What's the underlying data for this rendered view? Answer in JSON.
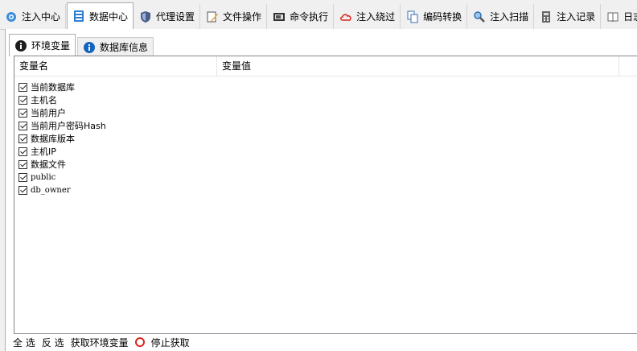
{
  "top_tabs": [
    {
      "label": "注入中心",
      "icon": "gear-icon"
    },
    {
      "label": "数据中心",
      "icon": "database-icon"
    },
    {
      "label": "代理设置",
      "icon": "shield-icon"
    },
    {
      "label": "文件操作",
      "icon": "edit-file-icon"
    },
    {
      "label": "命令执行",
      "icon": "terminal-icon"
    },
    {
      "label": "注入绕过",
      "icon": "cloud-icon"
    },
    {
      "label": "编码转换",
      "icon": "copy-icon"
    },
    {
      "label": "注入扫描",
      "icon": "magnifier-icon"
    },
    {
      "label": "注入记录",
      "icon": "calculator-icon"
    },
    {
      "label": "日志",
      "icon": "book-icon"
    }
  ],
  "active_top_tab": "数据中心",
  "sub_tabs": [
    {
      "label": "环境变量",
      "icon": "info-icon"
    },
    {
      "label": "数据库信息",
      "icon": "info-icon"
    }
  ],
  "table": {
    "columns": [
      "变量名",
      "变量值"
    ],
    "rows": [
      {
        "name": "当前数据库",
        "checked": true
      },
      {
        "name": "主机名",
        "checked": true
      },
      {
        "name": "当前用户",
        "checked": true
      },
      {
        "name": "当前用户密码Hash",
        "checked": true
      },
      {
        "name": "数据库版本",
        "checked": true
      },
      {
        "name": "主机IP",
        "checked": true
      },
      {
        "name": "数据文件",
        "checked": true
      },
      {
        "name": "public",
        "checked": true
      },
      {
        "name": "db_owner",
        "checked": true
      }
    ]
  },
  "bottom": {
    "select_all": "全 选",
    "invert": "反 选",
    "get_env": "获取环境变量",
    "stop": "停止获取"
  }
}
